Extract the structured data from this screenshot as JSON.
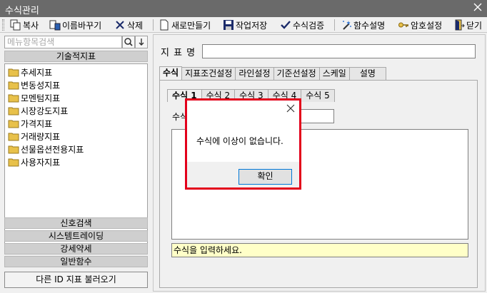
{
  "window": {
    "title": "수식관리"
  },
  "toolbar": {
    "items": [
      {
        "label": "복사",
        "icon": "copy-icon"
      },
      {
        "label": "이름바꾸기",
        "icon": "rename-icon"
      },
      {
        "label": "삭제",
        "icon": "delete-icon"
      },
      {
        "label": "새로만들기",
        "icon": "new-document-icon"
      },
      {
        "label": "작업저장",
        "icon": "save-icon"
      },
      {
        "label": "수식검증",
        "icon": "checkmark-icon"
      },
      {
        "label": "함수설명",
        "icon": "magic-wand-icon"
      },
      {
        "label": "암호설정",
        "icon": "key-icon"
      },
      {
        "label": "닫기",
        "icon": "exit-door-icon"
      }
    ]
  },
  "sidebar": {
    "search_placeholder": "메뉴항목검색",
    "category_header": "기술적지표",
    "tree_items": [
      "추세지표",
      "변동성지표",
      "모멘텀지표",
      "시장강도지표",
      "가격지표",
      "거래량지표",
      "선물옵션전용지표",
      "사용자지표"
    ],
    "sections": [
      "신호검색",
      "시스템트레이딩",
      "강세약세",
      "일반함수"
    ],
    "load_button": "다른 ID 지표 불러오기"
  },
  "main": {
    "name_label": "지 표 명",
    "name_value": "",
    "tabs": [
      "수식",
      "지표조건설정",
      "라인설정",
      "기준선설정",
      "스케일",
      "설명"
    ],
    "active_tab": "수식",
    "formula_tabs": [
      "수식 1",
      "수식 2",
      "수식 3",
      "수식 4",
      "수식 5"
    ],
    "formula_label": "수식",
    "hint_text": "수식을 입력하세요."
  },
  "dialog": {
    "message": "수식에 이상이 없습니다.",
    "ok_label": "확인"
  },
  "colors": {
    "titlebar": "#6a6a6a",
    "highlight_border": "#e3001b",
    "hint_background": "#ffffc8",
    "folder": "#e8c14a"
  }
}
